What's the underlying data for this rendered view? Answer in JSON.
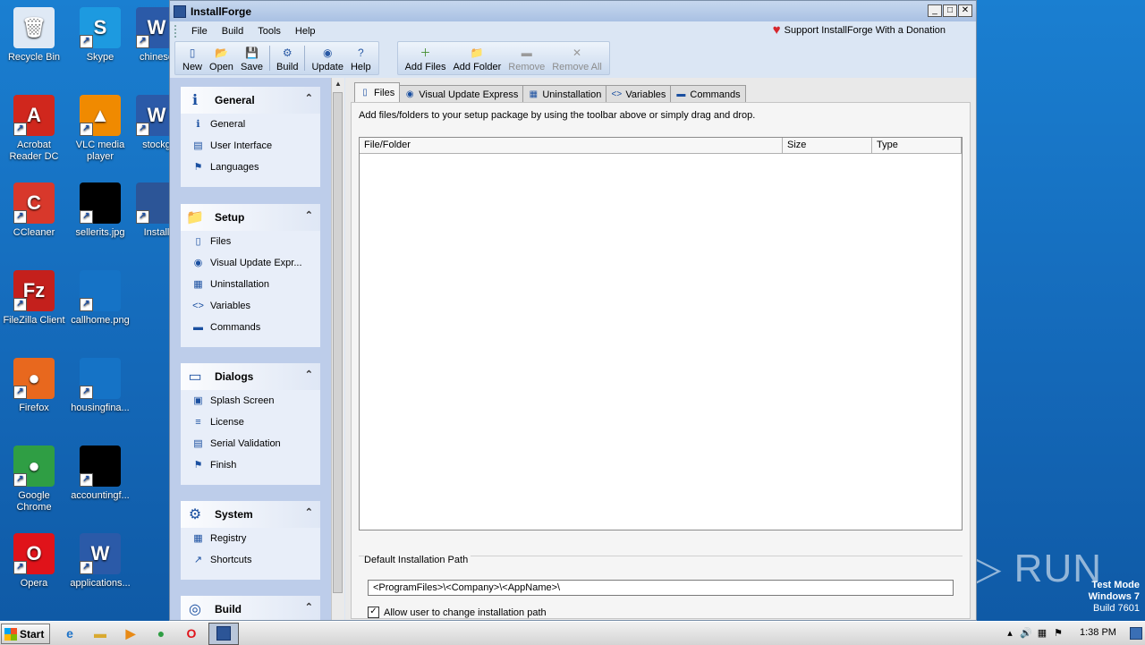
{
  "desktop": {
    "icons": [
      {
        "label": "Recycle Bin",
        "icon": "recycle-bin-icon",
        "glyph": "🗑",
        "color": "#dfe9f5"
      },
      {
        "label": "Skype",
        "icon": "skype-icon",
        "glyph": "S",
        "color": "#1d9ae0"
      },
      {
        "label": "chinese",
        "icon": "word-document-icon",
        "glyph": "W",
        "color": "#2b5aa8"
      },
      {
        "label": "Acrobat Reader DC",
        "icon": "acrobat-icon",
        "glyph": "A",
        "color": "#d0271d"
      },
      {
        "label": "VLC media player",
        "icon": "vlc-icon",
        "glyph": "▲",
        "color": "#f08a00"
      },
      {
        "label": "stockg",
        "icon": "word-document-icon",
        "glyph": "W",
        "color": "#2b5aa8"
      },
      {
        "label": "CCleaner",
        "icon": "ccleaner-icon",
        "glyph": "C",
        "color": "#d8382b"
      },
      {
        "label": "sellerits.jpg",
        "icon": "image-file-icon",
        "glyph": "",
        "color": "#000000"
      },
      {
        "label": "Install",
        "icon": "installforge-icon",
        "glyph": "",
        "color": "#2c5597"
      },
      {
        "label": "FileZilla Client",
        "icon": "filezilla-icon",
        "glyph": "Fz",
        "color": "#c4201c"
      },
      {
        "label": "callhome.png",
        "icon": "image-file-icon",
        "glyph": "",
        "color": "#1573c6"
      },
      {
        "label": "Firefox",
        "icon": "firefox-icon",
        "glyph": "●",
        "color": "#e8681e"
      },
      {
        "label": "housingfina...",
        "icon": "image-file-icon",
        "glyph": "",
        "color": "#1573c6"
      },
      {
        "label": "Google Chrome",
        "icon": "chrome-icon",
        "glyph": "●",
        "color": "#2f9e44"
      },
      {
        "label": "accountingf...",
        "icon": "image-file-icon",
        "glyph": "",
        "color": "#000000"
      },
      {
        "label": "Opera",
        "icon": "opera-icon",
        "glyph": "O",
        "color": "#e0131a"
      },
      {
        "label": "applications...",
        "icon": "word-document-icon",
        "glyph": "W",
        "color": "#2b5aa8"
      }
    ],
    "watermark": "ANY ▷ RUN",
    "testmode": {
      "line1": "Test Mode",
      "line2": "Windows 7",
      "line3": "Build 7601"
    }
  },
  "window": {
    "title": "InstallForge",
    "controls": {
      "min": "_",
      "max": "□",
      "close": "✕"
    },
    "menu": [
      "File",
      "Build",
      "Tools",
      "Help"
    ],
    "donation": "Support InstallForge With a Donation",
    "toolbar": {
      "group1": [
        {
          "label": "New",
          "icon": "new-icon",
          "glyph": "▯"
        },
        {
          "label": "Open",
          "icon": "open-folder-icon",
          "glyph": "📂"
        },
        {
          "label": "Save",
          "icon": "save-icon",
          "glyph": "💾"
        },
        {
          "label": "Build",
          "icon": "build-gear-icon",
          "glyph": "⚙"
        },
        {
          "label": "Update",
          "icon": "update-icon",
          "glyph": "◉"
        },
        {
          "label": "Help",
          "icon": "help-icon",
          "glyph": "?"
        }
      ],
      "group2": [
        {
          "label": "Add Files",
          "icon": "add-files-icon",
          "glyph": "＋",
          "disabled": false
        },
        {
          "label": "Add Folder",
          "icon": "add-folder-icon",
          "glyph": "📁",
          "disabled": false
        },
        {
          "label": "Remove",
          "icon": "remove-icon",
          "glyph": "▬",
          "disabled": true
        },
        {
          "label": "Remove All",
          "icon": "remove-all-icon",
          "glyph": "✕",
          "disabled": true
        }
      ]
    },
    "sidebar": {
      "groups": [
        {
          "title": "General",
          "icon": "info-icon",
          "glyph": "ℹ",
          "items": [
            {
              "label": "General",
              "icon": "info-icon",
              "glyph": "ℹ"
            },
            {
              "label": "User Interface",
              "icon": "user-interface-icon",
              "glyph": "▤"
            },
            {
              "label": "Languages",
              "icon": "languages-icon",
              "glyph": "⚑"
            }
          ]
        },
        {
          "title": "Setup",
          "icon": "folder-icon",
          "glyph": "📁",
          "items": [
            {
              "label": "Files",
              "icon": "files-icon",
              "glyph": "▯"
            },
            {
              "label": "Visual Update Expr...",
              "icon": "update-icon",
              "glyph": "◉"
            },
            {
              "label": "Uninstallation",
              "icon": "uninstall-icon",
              "glyph": "▦"
            },
            {
              "label": "Variables",
              "icon": "variables-icon",
              "glyph": "<>"
            },
            {
              "label": "Commands",
              "icon": "commands-icon",
              "glyph": "▬"
            }
          ]
        },
        {
          "title": "Dialogs",
          "icon": "dialog-icon",
          "glyph": "▭",
          "items": [
            {
              "label": "Splash Screen",
              "icon": "splash-screen-icon",
              "glyph": "▣"
            },
            {
              "label": "License",
              "icon": "license-icon",
              "glyph": "≡"
            },
            {
              "label": "Serial Validation",
              "icon": "serial-validation-icon",
              "glyph": "▤"
            },
            {
              "label": "Finish",
              "icon": "finish-flag-icon",
              "glyph": "⚑"
            }
          ]
        },
        {
          "title": "System",
          "icon": "system-gears-icon",
          "glyph": "⚙",
          "items": [
            {
              "label": "Registry",
              "icon": "registry-icon",
              "glyph": "▦"
            },
            {
              "label": "Shortcuts",
              "icon": "shortcuts-icon",
              "glyph": "↗"
            }
          ]
        },
        {
          "title": "Build",
          "icon": "build-disc-icon",
          "glyph": "◎",
          "items": []
        }
      ],
      "collapse_glyph": "⌃"
    },
    "tabs": [
      {
        "label": "Files",
        "icon": "files-icon",
        "glyph": "▯",
        "active": true
      },
      {
        "label": "Visual Update Express",
        "icon": "update-icon",
        "glyph": "◉",
        "active": false
      },
      {
        "label": "Uninstallation",
        "icon": "uninstall-icon",
        "glyph": "▦",
        "active": false
      },
      {
        "label": "Variables",
        "icon": "variables-icon",
        "glyph": "<>",
        "active": false
      },
      {
        "label": "Commands",
        "icon": "commands-icon",
        "glyph": "▬",
        "active": false
      }
    ],
    "files_tab": {
      "hint": "Add files/folders to your setup package by using the toolbar above or simply drag and drop.",
      "columns": [
        "File/Folder",
        "Size",
        "Type"
      ],
      "rows": [],
      "install_path_label": "Default Installation Path",
      "install_path_value": "<ProgramFiles>\\<Company>\\<AppName>\\",
      "allow_change_label": "Allow user to change installation path",
      "allow_change_checked": true
    }
  },
  "taskbar": {
    "start_label": "Start",
    "pinned": [
      {
        "icon": "ie-icon",
        "glyph": "e",
        "color": "#1e73c8"
      },
      {
        "icon": "explorer-icon",
        "glyph": "▬",
        "color": "#d9a930"
      },
      {
        "icon": "media-player-icon",
        "glyph": "▶",
        "color": "#e88a16"
      },
      {
        "icon": "chrome-icon",
        "glyph": "●",
        "color": "#2f9e44"
      },
      {
        "icon": "opera-icon",
        "glyph": "O",
        "color": "#e0131a"
      }
    ],
    "tray_icons": [
      {
        "icon": "volume-icon",
        "glyph": "🔊"
      },
      {
        "icon": "network-icon",
        "glyph": "▦"
      },
      {
        "icon": "action-center-flag-icon",
        "glyph": "⚑"
      }
    ],
    "time": "1:38 PM"
  }
}
